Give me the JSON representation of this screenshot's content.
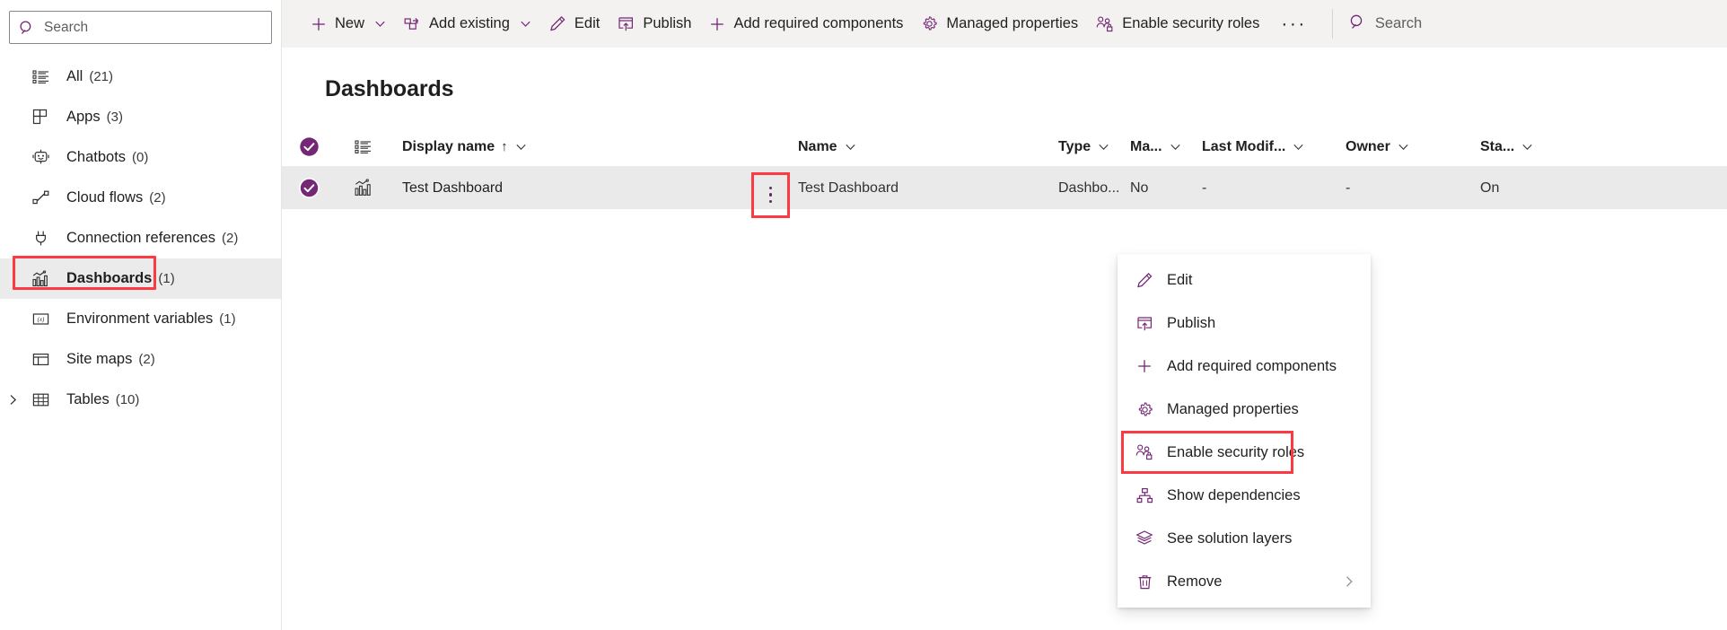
{
  "theme": {
    "accent": "#742774",
    "highlight": "#fb3b41",
    "toolbar_bg": "#f3f2f1",
    "row_selected_bg": "#eaeaea",
    "nav_selected_bg": "#ebebeb",
    "text": "#201f1e"
  },
  "sidebar": {
    "search": {
      "placeholder": "Search",
      "value": "",
      "icon": "search-icon"
    },
    "items": [
      {
        "label": "All",
        "count": "(21)",
        "icon": "list-icon",
        "selected": false,
        "expandable": false
      },
      {
        "label": "Apps",
        "count": "(3)",
        "icon": "apps-grid-icon",
        "selected": false,
        "expandable": false
      },
      {
        "label": "Chatbots",
        "count": "(0)",
        "icon": "chatbot-icon",
        "selected": false,
        "expandable": false
      },
      {
        "label": "Cloud flows",
        "count": "(2)",
        "icon": "cloud-flow-icon",
        "selected": false,
        "expandable": false
      },
      {
        "label": "Connection references",
        "count": "(2)",
        "icon": "connection-plug-icon",
        "selected": false,
        "expandable": false
      },
      {
        "label": "Dashboards",
        "count": "(1)",
        "icon": "dashboard-chart-icon",
        "selected": true,
        "expandable": false
      },
      {
        "label": "Environment variables",
        "count": "(1)",
        "icon": "environment-variable-icon",
        "selected": false,
        "expandable": false
      },
      {
        "label": "Site maps",
        "count": "(2)",
        "icon": "site-map-icon",
        "selected": false,
        "expandable": false
      },
      {
        "label": "Tables",
        "count": "(10)",
        "icon": "table-icon",
        "selected": false,
        "expandable": true
      }
    ]
  },
  "commandbar": {
    "items": [
      {
        "label": "New",
        "icon": "plus-icon",
        "caret": true
      },
      {
        "label": "Add existing",
        "icon": "add-existing-icon",
        "caret": true
      },
      {
        "label": "Edit",
        "icon": "pencil-icon",
        "caret": false
      },
      {
        "label": "Publish",
        "icon": "publish-icon",
        "caret": false
      },
      {
        "label": "Add required components",
        "icon": "plus-icon",
        "caret": false
      },
      {
        "label": "Managed properties",
        "icon": "gear-icon",
        "caret": false
      },
      {
        "label": "Enable security roles",
        "icon": "security-roles-icon",
        "caret": false
      }
    ],
    "overflow": "···",
    "search": {
      "placeholder": "Search",
      "value": "",
      "icon": "search-icon"
    }
  },
  "main": {
    "title": "Dashboards",
    "grid": {
      "header": {
        "select_all": "select-all-checkbox",
        "type_col_icon": "list-icon",
        "columns": [
          {
            "key": "display_name",
            "label": "Display name",
            "sorted": "↑",
            "caret": true
          },
          {
            "key": "name",
            "label": "Name",
            "sorted": "",
            "caret": true
          },
          {
            "key": "type",
            "label": "Type",
            "sorted": "",
            "caret": true
          },
          {
            "key": "managed",
            "label": "Ma...",
            "sorted": "",
            "caret": true
          },
          {
            "key": "last_modified",
            "label": "Last Modif...",
            "sorted": "",
            "caret": true
          },
          {
            "key": "owner",
            "label": "Owner",
            "sorted": "",
            "caret": true
          },
          {
            "key": "status",
            "label": "Sta...",
            "sorted": "",
            "caret": true
          }
        ]
      },
      "rows": [
        {
          "selected": true,
          "row_icon": "dashboard-chart-icon",
          "display_name": "Test Dashboard",
          "name": "Test Dashboard",
          "type": "Dashbo...",
          "managed": "No",
          "last_modified": "-",
          "owner": "-",
          "status": "On",
          "kebab": "more-actions-button"
        }
      ]
    }
  },
  "context_menu": {
    "items": [
      {
        "label": "Edit",
        "icon": "pencil-icon",
        "highlighted": false,
        "submenu": false
      },
      {
        "label": "Publish",
        "icon": "publish-icon",
        "highlighted": false,
        "submenu": false
      },
      {
        "label": "Add required components",
        "icon": "plus-icon",
        "highlighted": false,
        "submenu": false
      },
      {
        "label": "Managed properties",
        "icon": "gear-icon",
        "highlighted": false,
        "submenu": false
      },
      {
        "label": "Enable security roles",
        "icon": "security-roles-icon",
        "highlighted": true,
        "submenu": false
      },
      {
        "label": "Show dependencies",
        "icon": "dependencies-icon",
        "highlighted": false,
        "submenu": false
      },
      {
        "label": "See solution layers",
        "icon": "layers-icon",
        "highlighted": false,
        "submenu": false
      },
      {
        "label": "Remove",
        "icon": "trash-icon",
        "highlighted": false,
        "submenu": true
      }
    ]
  }
}
